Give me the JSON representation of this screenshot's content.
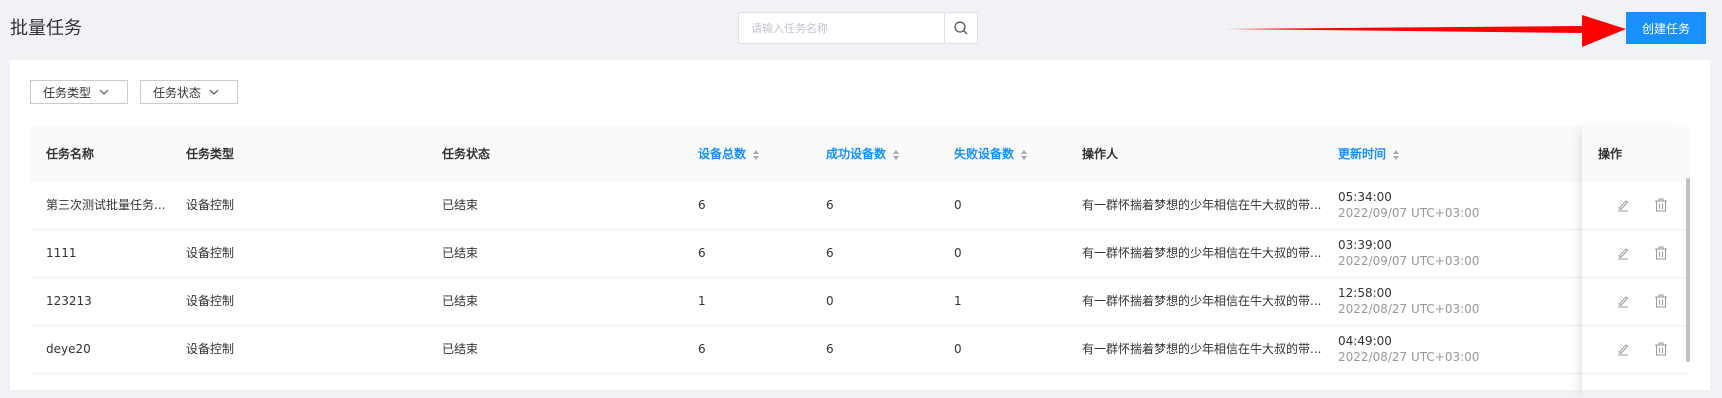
{
  "page": {
    "title": "批量任务"
  },
  "search": {
    "placeholder": "请输入任务名称",
    "value": ""
  },
  "header": {
    "create_label": "创建任务",
    "accent": "#1890ff",
    "annotation_arrow_color": "#ff0000"
  },
  "filters": {
    "type_label": "任务类型",
    "status_label": "任务状态"
  },
  "table": {
    "columns": [
      "任务名称",
      "任务类型",
      "任务状态",
      "设备总数",
      "成功设备数",
      "失败设备数",
      "操作人",
      "更新时间",
      "操作"
    ],
    "sortable_columns": [
      "设备总数",
      "成功设备数",
      "失败设备数",
      "更新时间"
    ],
    "rows": [
      {
        "name": "第三次测试批量任务...",
        "type": "设备控制",
        "status": "已结束",
        "total": "6",
        "success": "6",
        "fail": "0",
        "operator": "有一群怀揣着梦想的少年相信在牛大叔的带...",
        "time": "05:34:00",
        "date": "2022/09/07 UTC+03:00"
      },
      {
        "name": "1111",
        "type": "设备控制",
        "status": "已结束",
        "total": "6",
        "success": "6",
        "fail": "0",
        "operator": "有一群怀揣着梦想的少年相信在牛大叔的带...",
        "time": "03:39:00",
        "date": "2022/09/07 UTC+03:00"
      },
      {
        "name": "123213",
        "type": "设备控制",
        "status": "已结束",
        "total": "1",
        "success": "0",
        "fail": "1",
        "operator": "有一群怀揣着梦想的少年相信在牛大叔的带...",
        "time": "12:58:00",
        "date": "2022/08/27 UTC+03:00"
      },
      {
        "name": "deye20",
        "type": "设备控制",
        "status": "已结束",
        "total": "6",
        "success": "6",
        "fail": "0",
        "operator": "有一群怀揣着梦想的少年相信在牛大叔的带...",
        "time": "04:49:00",
        "date": "2022/08/27 UTC+03:00"
      }
    ],
    "row_actions": [
      "edit-icon",
      "delete-icon"
    ]
  }
}
